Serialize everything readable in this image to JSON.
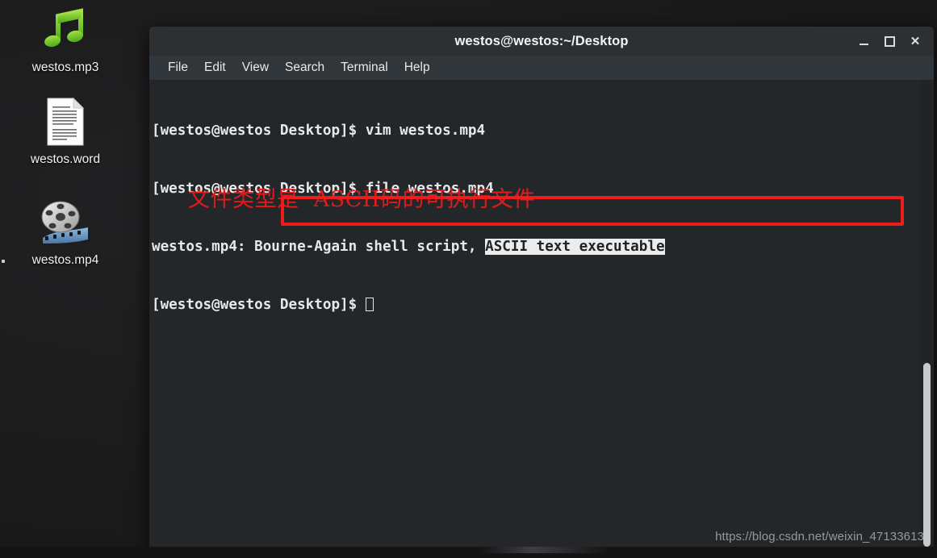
{
  "desktop": {
    "icons": [
      {
        "label": "westos.mp3",
        "icon": "music-note-icon"
      },
      {
        "label": "westos.word",
        "icon": "document-icon"
      },
      {
        "label": "westos.mp4",
        "icon": "film-reel-icon"
      }
    ]
  },
  "window": {
    "title": "westos@westos:~/Desktop",
    "controls": {
      "minimize": "minimize-icon",
      "maximize": "maximize-icon",
      "close": "close-icon"
    },
    "menu": [
      "File",
      "Edit",
      "View",
      "Search",
      "Terminal",
      "Help"
    ]
  },
  "terminal": {
    "lines": [
      {
        "prompt": "[westos@westos Desktop]$ ",
        "command": "vim westos.mp4"
      },
      {
        "prompt": "[westos@westos Desktop]$ ",
        "command": "file westos.mp4"
      }
    ],
    "output": {
      "plain": "westos.mp4: Bourne-Again shell script, ",
      "highlighted": "ASCII text executable"
    },
    "last_prompt": "[westos@westos Desktop]$ ",
    "cursor": "block-cursor"
  },
  "annotation": {
    "text": "文件类型是  ASCII码的可执行文件",
    "color": "#e01b1b"
  },
  "highlight_box": {
    "color": "#ee1c1c"
  },
  "watermark": {
    "text": "https://blog.csdn.net/weixin_47133613"
  },
  "colors": {
    "desktop_bg": "#1b1b1d",
    "titlebar_bg": "#2c3033",
    "menubar_bg": "#31363a",
    "terminal_bg": "#24272a",
    "terminal_fg": "#e8e8e8",
    "highlight_bg": "#ececec",
    "scrollbar_thumb": "#c9c9c9"
  }
}
